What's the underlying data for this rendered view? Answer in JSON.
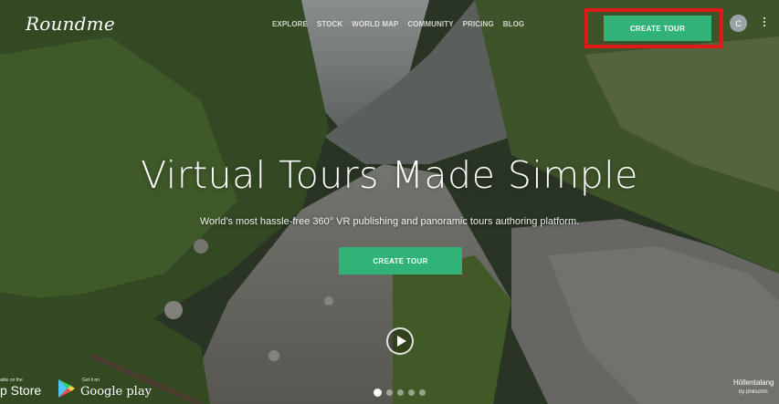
{
  "brand": {
    "logo_text": "Roundme"
  },
  "nav": {
    "items": [
      {
        "label": "EXPLORE"
      },
      {
        "label": "STOCK"
      },
      {
        "label": "WORLD MAP"
      },
      {
        "label": "COMMUNITY"
      },
      {
        "label": "PRICING"
      },
      {
        "label": "BLOG"
      }
    ],
    "create_tour_label": "CREATE TOUR",
    "avatar_initial": "C"
  },
  "hero": {
    "title": "Virtual Tours Made Simple",
    "subtitle": "World's most hassle-free 360° VR publishing and panoramic tours authoring platform.",
    "cta_label": "CREATE TOUR"
  },
  "stores": {
    "appstore_small": "able on the",
    "appstore_label": "p Store",
    "googleplay_small": "Get it on",
    "googleplay_label": "Google play"
  },
  "credit": {
    "title": "Höllentalang",
    "by": "by philschm"
  },
  "carousel": {
    "count": 5,
    "active_index": 0
  },
  "colors": {
    "accent": "#31b276",
    "highlight": "#e01818"
  }
}
